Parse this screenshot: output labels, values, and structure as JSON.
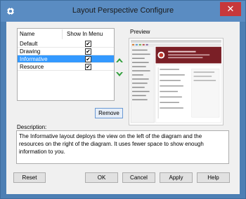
{
  "window": {
    "title": "Layout Perspective Configure",
    "close_glyph": "✕",
    "colors": {
      "frame": "#5a8cc2",
      "close": "#c7383b",
      "selection": "#3399ff"
    }
  },
  "list": {
    "columns": [
      "Name",
      "Show In Menu"
    ],
    "rows": [
      {
        "name": "Default",
        "show": true,
        "selected": false
      },
      {
        "name": "Drawing",
        "show": true,
        "selected": false
      },
      {
        "name": "Informative",
        "show": true,
        "selected": true
      },
      {
        "name": "Resource",
        "show": true,
        "selected": false
      }
    ],
    "check_glyph": "✔"
  },
  "preview": {
    "label": "Preview"
  },
  "actions": {
    "remove": "Remove"
  },
  "description": {
    "label": "Description:",
    "text": "The Informative layout deploys the view on the left of the diagram and the resources on the right of the diagram. It uses fewer space to show enough information to you."
  },
  "footer": {
    "reset": "Reset",
    "ok": "OK",
    "cancel": "Cancel",
    "apply": "Apply",
    "help": "Help"
  },
  "icons": {
    "app": "app-gear-icon",
    "move_up": "arrow-up-icon",
    "move_down": "arrow-down-icon"
  }
}
